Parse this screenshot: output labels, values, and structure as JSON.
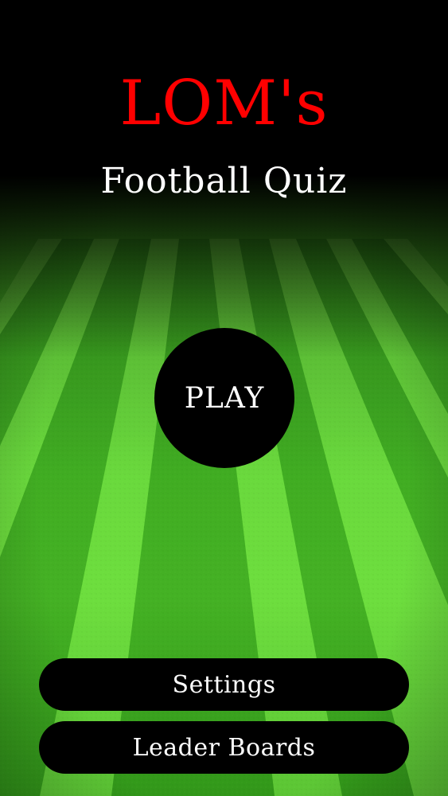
{
  "title": {
    "main": "LOM's",
    "sub": "Football Quiz"
  },
  "buttons": {
    "play": "PLAY",
    "settings": "Settings",
    "leaderboards": "Leader Boards"
  },
  "colors": {
    "title_main": "#ff0000",
    "title_sub": "#ffffff",
    "button_bg": "#000000",
    "button_text": "#ffffff",
    "grass_light": "#6ee03a",
    "grass_dark": "#2f9a1c"
  }
}
